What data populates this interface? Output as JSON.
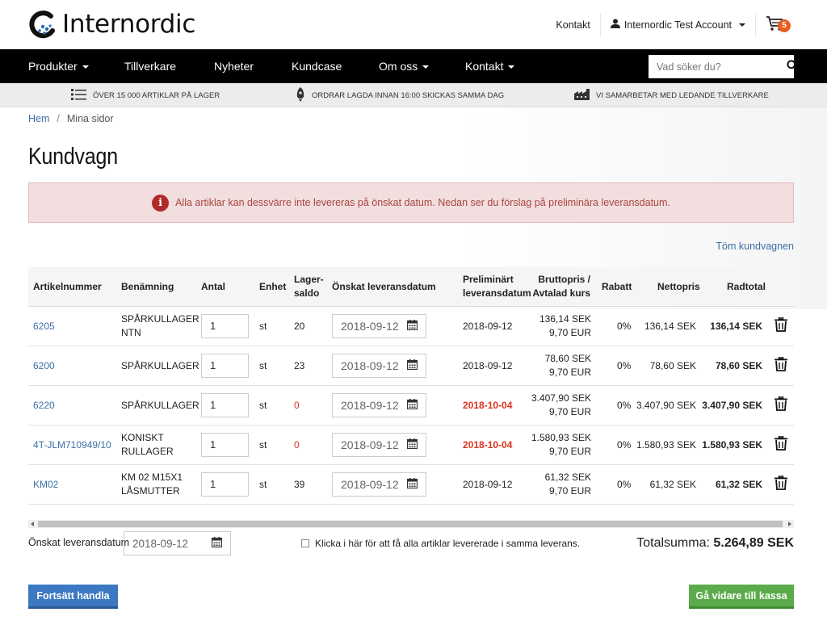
{
  "brand": {
    "name": "Internordic"
  },
  "header": {
    "contact_link": "Kontakt",
    "account_name": "Internordic Test Account",
    "cart_count": "5"
  },
  "nav": {
    "items": [
      {
        "label": "Produkter",
        "dropdown": true
      },
      {
        "label": "Tillverkare",
        "dropdown": false
      },
      {
        "label": "Nyheter",
        "dropdown": false
      },
      {
        "label": "Kundcase",
        "dropdown": false
      },
      {
        "label": "Om oss",
        "dropdown": true
      },
      {
        "label": "Kontakt",
        "dropdown": true
      }
    ],
    "search_placeholder": "Vad söker du?"
  },
  "usp": {
    "items": [
      {
        "icon": "list-icon",
        "text": "ÖVER 15 000 ARTIKLAR PÅ LAGER"
      },
      {
        "icon": "rocket-icon",
        "text": "ORDRAR LAGDA INNAN 16:00 SKICKAS SAMMA DAG"
      },
      {
        "icon": "factory-icon",
        "text": "VI SAMARBETAR MED LEDANDE TILLVERKARE"
      }
    ]
  },
  "breadcrumb": {
    "home": "Hem",
    "current": "Mina sidor"
  },
  "page": {
    "title": "Kundvagn"
  },
  "alert": {
    "text": "Alla artiklar kan dessvärre inte levereras på önskat datum. Nedan ser du förslag på preliminära leveransdatum."
  },
  "actions": {
    "clear_cart": "Töm kundvagnen"
  },
  "table": {
    "headers": {
      "article": "Artikelnummer",
      "name": "Benämning",
      "qty": "Antal",
      "unit": "Enhet",
      "stock_1": "Lager-",
      "stock_2": "saldo",
      "wanted": "Önskat leveransdatum",
      "prelim_1": "Preliminärt",
      "prelim_2": "leveransdatum",
      "gross_1": "Bruttopris /",
      "gross_2": "Avtalad kurs",
      "discount": "Rabatt",
      "net": "Nettopris",
      "total": "Radtotal"
    },
    "rows": [
      {
        "article": "6205",
        "name_1": "SPÅRKULLAGER",
        "name_2": "NTN",
        "qty": "1",
        "unit": "st",
        "stock": "20",
        "wanted": "2018-09-12",
        "prelim": "2018-09-12",
        "prelim_late": false,
        "gross": "136,14 SEK",
        "rate": "9,70 EUR",
        "discount": "0%",
        "net": "136,14 SEK",
        "total": "136,14 SEK"
      },
      {
        "article": "6200",
        "name_1": "SPÅRKULLAGER",
        "name_2": "",
        "qty": "1",
        "unit": "st",
        "stock": "23",
        "wanted": "2018-09-12",
        "prelim": "2018-09-12",
        "prelim_late": false,
        "gross": "78,60 SEK",
        "rate": "9,70 EUR",
        "discount": "0%",
        "net": "78,60 SEK",
        "total": "78,60 SEK"
      },
      {
        "article": "6220",
        "name_1": "SPÅRKULLAGER",
        "name_2": "",
        "qty": "1",
        "unit": "st",
        "stock": "0",
        "wanted": "2018-09-12",
        "prelim": "2018-10-04",
        "prelim_late": true,
        "gross": "3.407,90 SEK",
        "rate": "9,70 EUR",
        "discount": "0%",
        "net": "3.407,90 SEK",
        "total": "3.407,90 SEK"
      },
      {
        "article": "4T-JLM710949/10",
        "name_1": "KONISKT",
        "name_2": "RULLAGER",
        "qty": "1",
        "unit": "st",
        "stock": "0",
        "wanted": "2018-09-12",
        "prelim": "2018-10-04",
        "prelim_late": true,
        "gross": "1.580,93 SEK",
        "rate": "9,70 EUR",
        "discount": "0%",
        "net": "1.580,93 SEK",
        "total": "1.580,93 SEK"
      },
      {
        "article": "KM02",
        "name_1": "KM 02 M15X1",
        "name_2": "LÅSMUTTER",
        "qty": "1",
        "unit": "st",
        "stock": "39",
        "wanted": "2018-09-12",
        "prelim": "2018-09-12",
        "prelim_late": false,
        "gross": "61,32 SEK",
        "rate": "9,70 EUR",
        "discount": "0%",
        "net": "61,32 SEK",
        "total": "61,32 SEK"
      }
    ]
  },
  "footer": {
    "wanted_label": "Önskat leveransdatum",
    "wanted_date": "2018-09-12",
    "same_delivery_label": "Klicka i här för att få alla artiklar levererade i samma leverans.",
    "total_label": "Totalsumma:",
    "total_value": "5.264,89 SEK"
  },
  "buttons": {
    "continue": "Fortsätt handla",
    "checkout": "Gå vidare till kassa"
  },
  "colors": {
    "link": "#3c6ea6",
    "alert_bg": "#f2dede",
    "alert_text": "#a94442",
    "late_date": "#d9341d",
    "badge": "#e85d1f",
    "btn_primary": "#3d78c2",
    "btn_success": "#5bab4a"
  }
}
